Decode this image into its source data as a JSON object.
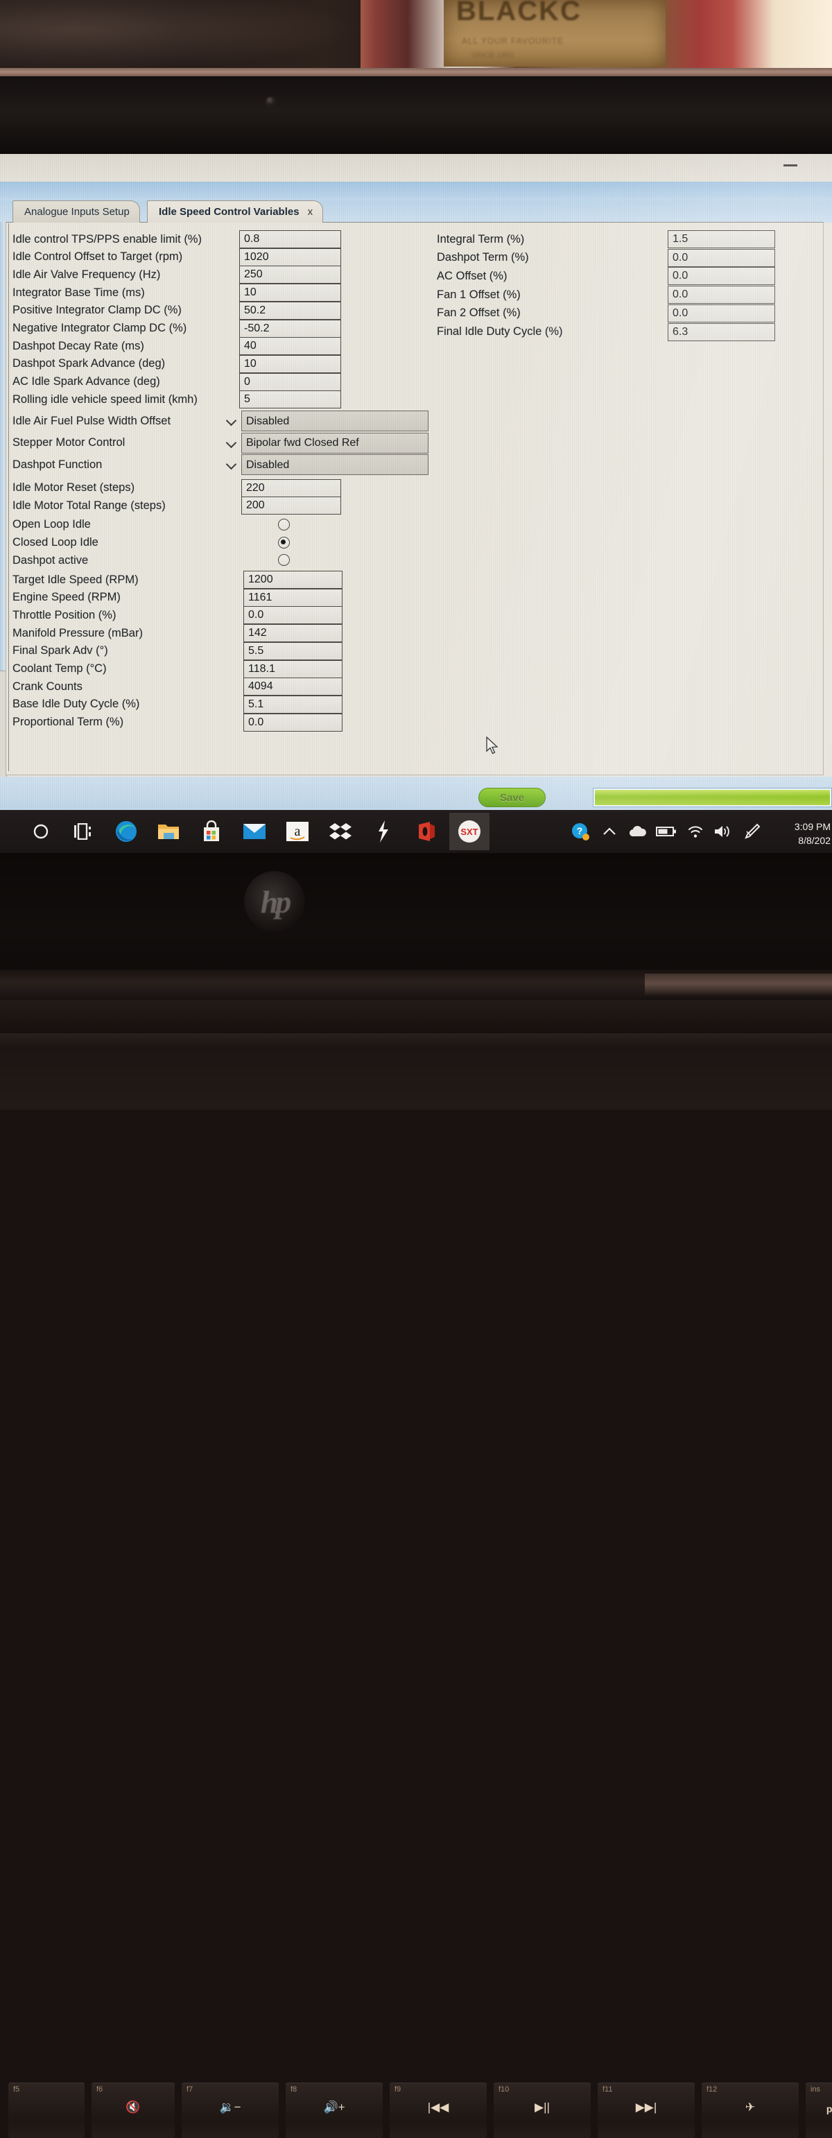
{
  "photo": {
    "background_sign_line1": "BLACKC",
    "background_sign_line2": "ALL YOUR FAVOURITE",
    "background_sign_line3": "SINCE 1952",
    "laptop_brand": "hp"
  },
  "window": {
    "minimize_label": "—"
  },
  "tabs": [
    {
      "label": "Analogue Inputs Setup",
      "active": false
    },
    {
      "label": "Idle Speed Control Variables",
      "active": true,
      "close": "x"
    }
  ],
  "left_column": {
    "number_fields": [
      {
        "label": "Idle control TPS/PPS enable limit (%)",
        "value": "0.8"
      },
      {
        "label": "Idle Control Offset to Target (rpm)",
        "value": "1020"
      },
      {
        "label": "Idle Air Valve Frequency (Hz)",
        "value": "250"
      },
      {
        "label": "Integrator Base Time (ms)",
        "value": "10"
      },
      {
        "label": "Positive Integrator Clamp DC (%)",
        "value": "50.2"
      },
      {
        "label": "Negative Integrator Clamp DC (%)",
        "value": "-50.2"
      },
      {
        "label": "Dashpot Decay Rate (ms)",
        "value": "40"
      },
      {
        "label": "Dashpot Spark Advance (deg)",
        "value": "10"
      },
      {
        "label": "AC Idle Spark Advance (deg)",
        "value": "0"
      },
      {
        "label": "Rolling idle vehicle speed limit (kmh)",
        "value": "5"
      }
    ],
    "dropdowns": [
      {
        "label": "Idle Air Fuel Pulse Width Offset",
        "value": "Disabled"
      },
      {
        "label": "Stepper Motor Control",
        "value": "Bipolar fwd Closed Ref"
      },
      {
        "label": "Dashpot Function",
        "value": "Disabled"
      }
    ],
    "motor_fields": [
      {
        "label": "Idle Motor Reset (steps)",
        "value": "220"
      },
      {
        "label": "Idle Motor Total Range (steps)",
        "value": "200"
      }
    ],
    "radios": [
      {
        "label": "Open Loop Idle",
        "selected": false
      },
      {
        "label": "Closed Loop Idle",
        "selected": true
      },
      {
        "label": "Dashpot active",
        "selected": false
      }
    ],
    "readouts": [
      {
        "label": "Target Idle Speed (RPM)",
        "value": "1200"
      },
      {
        "label": "Engine Speed (RPM)",
        "value": "1161"
      },
      {
        "label": "Throttle Position (%)",
        "value": "0.0"
      },
      {
        "label": "Manifold Pressure (mBar)",
        "value": "142"
      },
      {
        "label": "Final Spark Adv (°)",
        "value": "5.5"
      },
      {
        "label": "Coolant Temp (°C)",
        "value": "118.1"
      },
      {
        "label": "Crank Counts",
        "value": "4094"
      },
      {
        "label": "Base Idle Duty Cycle (%)",
        "value": "5.1"
      },
      {
        "label": "Proportional Term (%)",
        "value": "0.0"
      }
    ]
  },
  "right_column": {
    "readouts": [
      {
        "label": "Integral Term (%)",
        "value": "1.5"
      },
      {
        "label": "Dashpot Term (%)",
        "value": "0.0"
      },
      {
        "label": "AC Offset (%)",
        "value": "0.0"
      },
      {
        "label": "Fan 1 Offset (%)",
        "value": "0.0"
      },
      {
        "label": "Fan 2 Offset (%)",
        "value": "0.0"
      },
      {
        "label": "Final Idle Duty Cycle (%)",
        "value": "6.3"
      }
    ]
  },
  "bottom_bar": {
    "save_label": "Save",
    "progress_percent": 100
  },
  "taskbar": {
    "pinned": [
      {
        "name": "cortana-icon",
        "glyph": "◯"
      },
      {
        "name": "task-view-icon",
        "glyph": ""
      },
      {
        "name": "edge-icon",
        "glyph": ""
      },
      {
        "name": "file-explorer-icon",
        "glyph": ""
      },
      {
        "name": "microsoft-store-icon",
        "glyph": ""
      },
      {
        "name": "mail-icon",
        "glyph": ""
      },
      {
        "name": "amazon-icon",
        "glyph": "a"
      },
      {
        "name": "dropbox-icon",
        "glyph": ""
      },
      {
        "name": "lightning-app-icon",
        "glyph": ""
      },
      {
        "name": "office-icon",
        "glyph": ""
      },
      {
        "name": "sxt-app-icon",
        "glyph": "SXT"
      }
    ],
    "tray": [
      {
        "name": "help-icon",
        "glyph": "?"
      },
      {
        "name": "chevron-up-icon",
        "glyph": "^"
      },
      {
        "name": "onedrive-cloud-icon",
        "glyph": ""
      },
      {
        "name": "battery-icon",
        "glyph": ""
      },
      {
        "name": "wifi-icon",
        "glyph": ""
      },
      {
        "name": "volume-icon",
        "glyph": ""
      },
      {
        "name": "pen-icon",
        "glyph": ""
      }
    ],
    "clock_time": "3:09 PM",
    "clock_date": "8/8/202"
  },
  "keyboard": {
    "keys": [
      {
        "fnum": "f5",
        "glyph": ""
      },
      {
        "fnum": "f6",
        "glyph": "🔇"
      },
      {
        "fnum": "f7",
        "glyph": "🔉−"
      },
      {
        "fnum": "f8",
        "glyph": "🔊+"
      },
      {
        "fnum": "f9",
        "glyph": "|◀◀"
      },
      {
        "fnum": "f10",
        "glyph": "▶||"
      },
      {
        "fnum": "f11",
        "glyph": "▶▶|"
      },
      {
        "fnum": "f12",
        "glyph": "✈"
      },
      {
        "fnum": "ins",
        "glyph": "prt s"
      }
    ]
  }
}
